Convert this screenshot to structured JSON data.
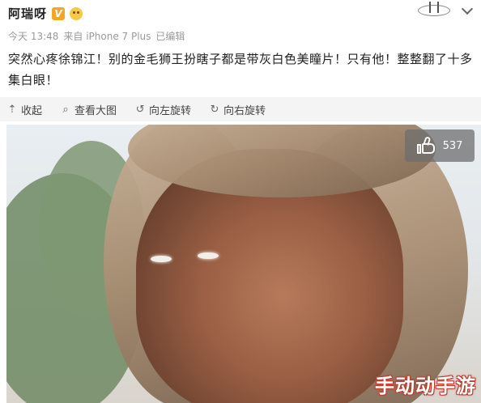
{
  "post": {
    "username": "阿瑞呀",
    "verified_glyph": "V",
    "meta": {
      "time": "今天 13:48",
      "source": "来自 iPhone 7 Plus",
      "edited": "已编辑"
    },
    "text": "突然心疼徐锦江！别的金毛狮王扮瞎子都是带灰白色美瞳片！只有他！整整翻了十多集白眼！"
  },
  "toolbar": {
    "items": [
      {
        "icon": "collapse-icon",
        "glyph": "⇡",
        "label": "收起"
      },
      {
        "icon": "zoom-icon",
        "glyph": "⌕",
        "label": "查看大图"
      },
      {
        "icon": "rotate-left-icon",
        "glyph": "↺",
        "label": "向左旋转"
      },
      {
        "icon": "rotate-right-icon",
        "glyph": "↻",
        "label": "向右旋转"
      }
    ]
  },
  "image": {
    "like_count": "537",
    "watermark": "手动动手游"
  },
  "colors": {
    "badge": "#f5a623",
    "meta_text": "#9a9a9a",
    "toolbar_bg": "#f4f4f4",
    "watermark_outline": "#c0392b"
  }
}
